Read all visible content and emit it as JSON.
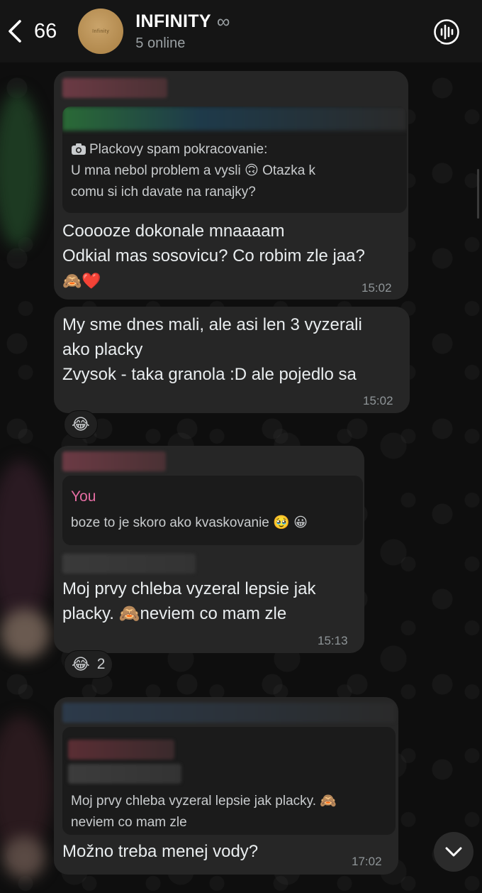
{
  "header": {
    "back_count": "66",
    "avatar_text": "Infinity",
    "title": "INFINITY",
    "title_symbol": "∞",
    "subtitle": "5 online"
  },
  "messages": [
    {
      "quote_text_1": "Plackovy spam pokracovanie:",
      "quote_text_2": "U mna nebol problem a vysli 🙃 Otazka k",
      "quote_text_3": "comu si ich davate na ranajky?",
      "line_1": "Cooooze dokonale mnaaaam",
      "line_2": "Odkial mas sosovicu? Co robim zle jaa?",
      "line_3": "🙈❤️",
      "time": "15:02"
    },
    {
      "line_1": "My sme dnes mali, ale asi len 3 vyzerali",
      "line_2": "ako placky",
      "line_3": "Zvysok - taka granola :D ale pojedlo sa",
      "time": "15:02",
      "reaction": "😂"
    },
    {
      "quote_author": "You",
      "quote_text": "boze to je skoro ako kvaskovanie 🥹 😀",
      "line_1": "Moj prvy chleba vyzeral lepsie jak",
      "line_2": "placky. 🙈neviem co mam zle",
      "time": "15:13",
      "reaction": "😂",
      "reaction_count": "2"
    },
    {
      "quote_text_1": "Moj prvy chleba vyzeral lepsie jak placky. 🙈",
      "quote_text_2": "neviem co mam zle",
      "line_1": "Možno treba menej vody?",
      "time": "17:02"
    }
  ],
  "colors": {
    "header_bg": "#151515",
    "bubble_bg": "#262626",
    "quote_bg": "#1b1b1b",
    "you_color": "#e46da2",
    "avatar_gold": "#b8915a"
  },
  "icons": [
    "chevron-left-icon",
    "voice-chat-icon",
    "camera-icon",
    "chevron-down-icon"
  ]
}
